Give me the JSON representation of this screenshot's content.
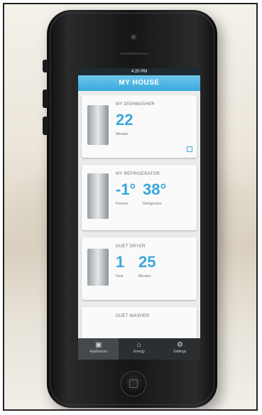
{
  "screen": {
    "status_time": "4:20 PM",
    "nav_title": "MY HOUSE"
  },
  "cards": [
    {
      "title": "MY DISHWASHER",
      "value": "22",
      "label": "Minutes"
    },
    {
      "title": "MY REFRIGERATOR",
      "freezer_value": "-1°",
      "fridge_value": "38°",
      "freezer_label": "Freezer",
      "fridge_label": "Refrigerator"
    },
    {
      "title": "DUET DRYER",
      "hour_value": "1",
      "minute_value": "25",
      "hour_label": "Hour",
      "minute_label": "Minutes"
    },
    {
      "title": "DUET WASHER"
    }
  ],
  "tabs": [
    {
      "label": "Appliances",
      "icon": "appliance-icon"
    },
    {
      "label": "Energy",
      "icon": "home-icon"
    },
    {
      "label": "Settings",
      "icon": "gear-icon"
    }
  ]
}
